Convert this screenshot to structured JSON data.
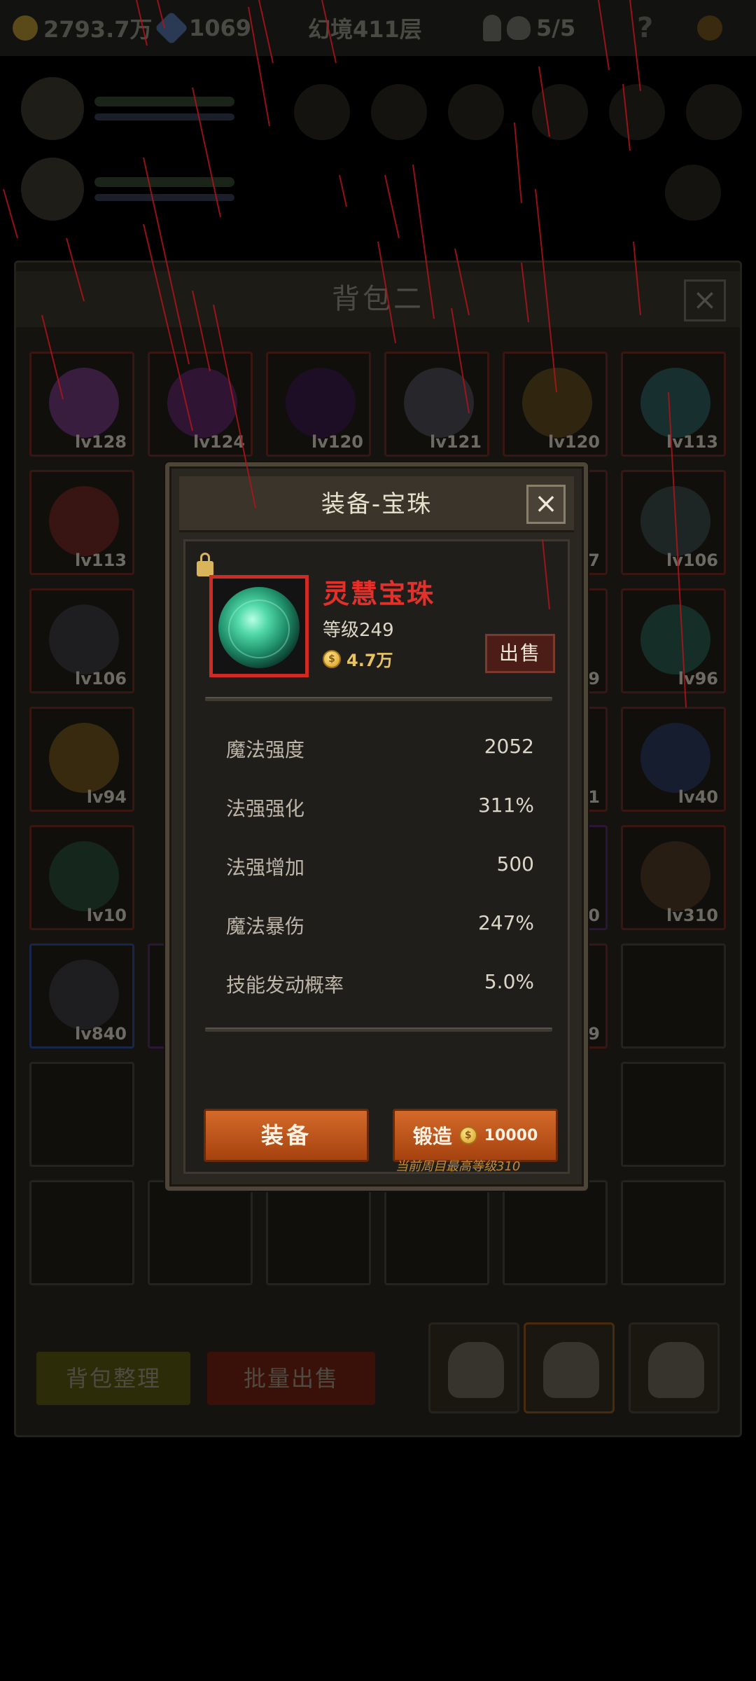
{
  "hud": {
    "gold": "2793.7万",
    "gems": "1069",
    "stage": "幻境411层",
    "skulls": "5/5",
    "help": "?"
  },
  "backpack": {
    "title": "背包二",
    "close": "×",
    "sort_button": "背包整理",
    "batch_sell_button": "批量出售",
    "grid_levels": [
      [
        "lv128",
        "lv124",
        "lv120",
        "lv121",
        "lv120",
        "lv113"
      ],
      [
        "lv113",
        "",
        "",
        "",
        "7",
        "lv106"
      ],
      [
        "lv106",
        "",
        "",
        "",
        "9",
        "lv96"
      ],
      [
        "lv94",
        "",
        "",
        "",
        "1",
        "lv40"
      ],
      [
        "lv10",
        "",
        "",
        "",
        "0",
        "lv310"
      ],
      [
        "lv840",
        "",
        "",
        "",
        "9",
        ""
      ]
    ]
  },
  "modal": {
    "title": "装备-宝珠",
    "close": "×",
    "item_name": "灵慧宝珠",
    "item_level": "等级249",
    "price": "4.7万",
    "sell_button": "出售",
    "stats": [
      {
        "name": "魔法强度",
        "value": "2052"
      },
      {
        "name": "法强强化",
        "value": "311%"
      },
      {
        "name": "法强增加",
        "value": "500"
      },
      {
        "name": "魔法暴伤",
        "value": "247%"
      },
      {
        "name": "技能发动概率",
        "value": "5.0%"
      }
    ],
    "equip_button": "装备",
    "forge_button": "锻造",
    "forge_cost": "10000",
    "note": "当前周目最高等级310",
    "coin_symbol": "$"
  },
  "colors": {
    "item_name": "#e2302a",
    "button_orange": "#c4571c",
    "price_gold": "#e8c360"
  }
}
